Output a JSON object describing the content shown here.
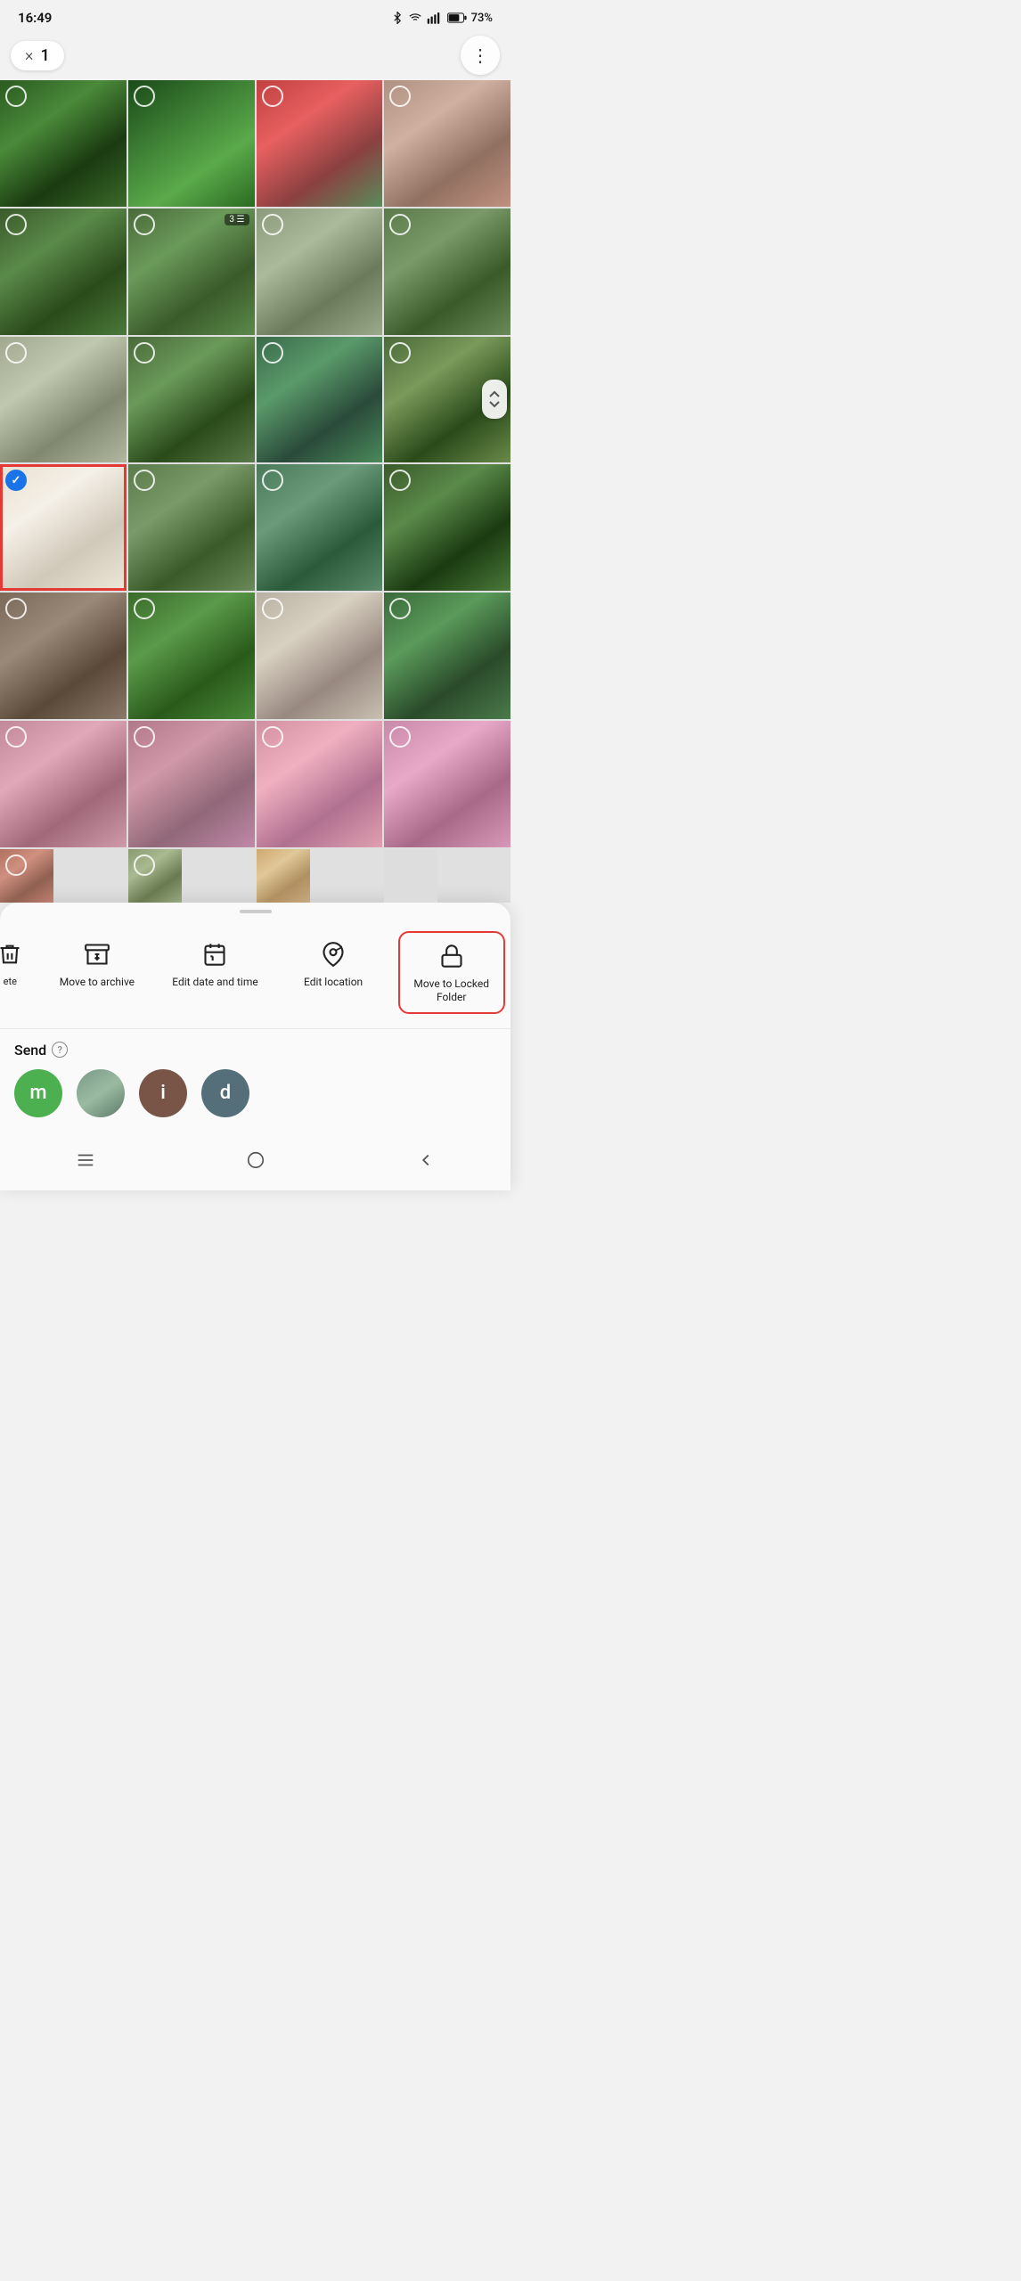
{
  "statusBar": {
    "time": "16:49",
    "battery": "73%",
    "signal": "●●●",
    "wifi": "wifi",
    "bluetooth": "bluetooth"
  },
  "topBar": {
    "closeLabel": "×",
    "selectionCount": "1",
    "moreIcon": "⋮"
  },
  "photoGrid": {
    "rows": [
      [
        "bg-green-dark",
        "bg-greenhouse",
        "bg-cactus",
        "bg-cactus2"
      ],
      [
        "bg-cactus3",
        "bg-cactus4",
        "bg-cactus",
        "bg-cactus2"
      ],
      [
        "bg-cactus3",
        "bg-cactus4",
        "bg-cactus",
        "bg-cactus2"
      ],
      [
        "bg-flower-white",
        "bg-green-cacti",
        "bg-green-cacti",
        "bg-cactus3"
      ],
      [
        "bg-pebble",
        "bg-leafy",
        "bg-fluffy",
        "bg-garden"
      ],
      [
        "bg-pink1",
        "bg-pink2",
        "bg-pink3",
        "bg-pink4"
      ],
      [
        "bg-partial1",
        "bg-partial2"
      ]
    ]
  },
  "bottomSheet": {
    "handle": true,
    "actions": [
      {
        "id": "delete",
        "label": "ete",
        "iconType": "delete",
        "highlighted": false
      },
      {
        "id": "move-to-archive",
        "label": "Move to archive",
        "iconType": "archive",
        "highlighted": false
      },
      {
        "id": "edit-date-time",
        "label": "Edit date and time",
        "iconType": "calendar",
        "highlighted": false
      },
      {
        "id": "edit-location",
        "label": "Edit location",
        "iconType": "location",
        "highlighted": false
      },
      {
        "id": "move-to-locked",
        "label": "Move to Locked Folder",
        "iconType": "lock",
        "highlighted": true
      }
    ],
    "send": {
      "title": "Send",
      "helpIcon": "?",
      "contacts": [
        {
          "id": "m",
          "initial": "m",
          "color": "#4CAF50"
        },
        {
          "id": "landscape",
          "initial": "🌄",
          "color": "#9E9E9E"
        },
        {
          "id": "i",
          "initial": "i",
          "color": "#795548"
        },
        {
          "id": "d",
          "initial": "d",
          "color": "#607D8B"
        }
      ]
    }
  },
  "navBar": {
    "menu": "menu",
    "home": "home",
    "back": "back"
  }
}
